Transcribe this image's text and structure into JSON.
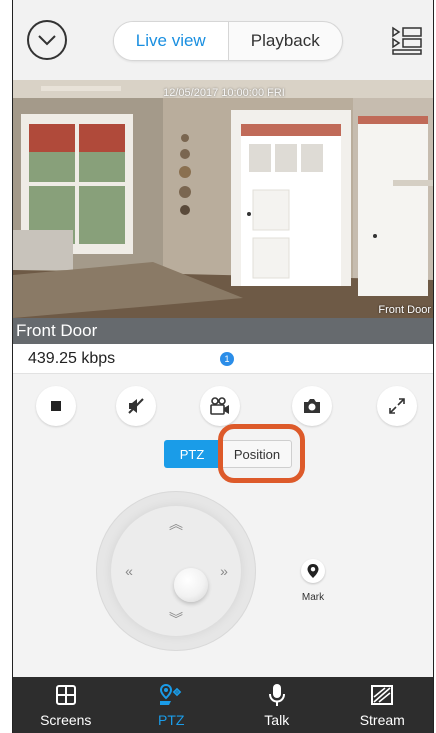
{
  "header": {
    "tabs": [
      {
        "label": "Live view",
        "active": true
      },
      {
        "label": "Playback",
        "active": false
      }
    ]
  },
  "video": {
    "timestamp": "12/05/2017 10:00:00 FRI",
    "camera_overlay": "Front Door"
  },
  "camera_name": "Front Door",
  "status": {
    "bitrate": "439.25 kbps",
    "page_indicator": "1"
  },
  "controls": [
    "stop",
    "mute",
    "record",
    "snapshot",
    "fullscreen"
  ],
  "mode_toggle": {
    "ptz_label": "PTZ",
    "position_label": "Position",
    "active": "PTZ"
  },
  "joystick": {
    "up": "︽",
    "down": "︾",
    "left": "«",
    "right": "»"
  },
  "mark": {
    "label": "Mark"
  },
  "bottom_nav": [
    {
      "label": "Screens",
      "icon": "screens-icon",
      "active": false
    },
    {
      "label": "PTZ",
      "icon": "ptz-icon",
      "active": true
    },
    {
      "label": "Talk",
      "icon": "microphone-icon",
      "active": false
    },
    {
      "label": "Stream",
      "icon": "stream-icon",
      "active": false
    }
  ],
  "colors": {
    "accent": "#1a9ce8",
    "highlight": "#dd5a2a",
    "nav_bg": "#2d2d2d"
  }
}
